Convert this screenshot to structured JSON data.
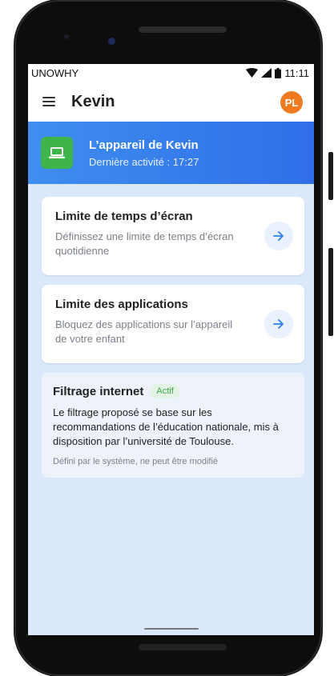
{
  "status_bar": {
    "carrier": "UNOWHY",
    "time": "11:11"
  },
  "app_bar": {
    "title": "Kevin",
    "avatar_initials": "PL"
  },
  "device": {
    "name": "L’appareil de Kevin",
    "last_activity": "Dernière activité : 17:27"
  },
  "cards": [
    {
      "title": "Limite de temps d’écran",
      "description": "Définissez une limite de temps d’écran quotidienne"
    },
    {
      "title": "Limite des applications",
      "description": "Bloquez des applications sur l’appareil de votre enfant"
    }
  ],
  "filter": {
    "title": "Filtrage internet",
    "badge": "Actif",
    "body": "Le filtrage proposé se base sur les recommandations de l’éducation nationale, mis à disposition par l’université de Toulouse.",
    "note": "Défini par le système, ne peut être modifié"
  },
  "icons": {
    "menu": "hamburger-menu-icon",
    "device": "laptop-icon",
    "arrow": "arrow-right-icon",
    "wifi": "wifi-icon",
    "signal": "signal-icon",
    "battery": "battery-icon"
  },
  "colors": {
    "banner": "#3f8ef0",
    "device_icon_bg": "#3fb44a",
    "avatar_bg": "#f07a1f",
    "accent": "#2f80ed",
    "badge_text": "#3aa247",
    "background": "#dbe7fb"
  }
}
